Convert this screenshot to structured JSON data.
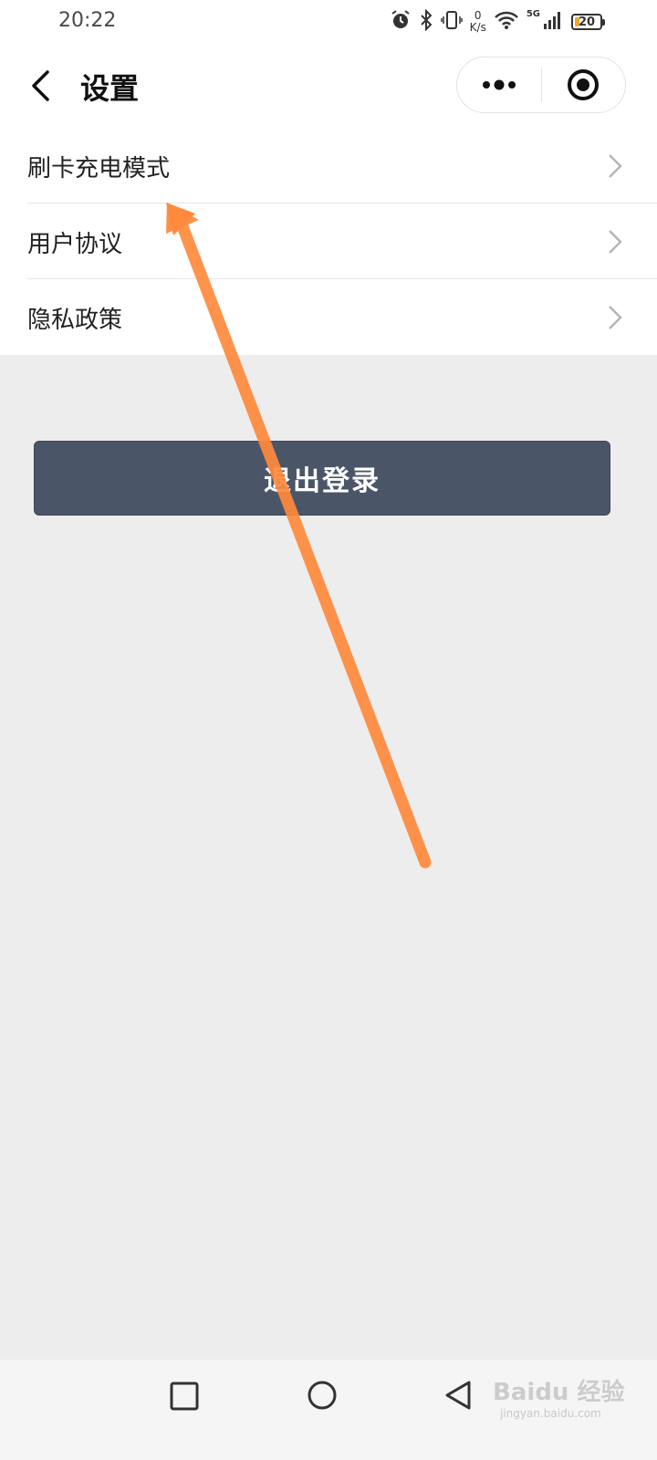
{
  "status_bar": {
    "time": "20:22",
    "net_speed_value": "0",
    "net_speed_unit": "K/s",
    "signal_label": "5G",
    "battery": "20",
    "battery_level": 0.2
  },
  "nav": {
    "title": "设置"
  },
  "menu": {
    "items": [
      {
        "label": "刷卡充电模式"
      },
      {
        "label": "用户协议"
      },
      {
        "label": "隐私政策"
      }
    ]
  },
  "logout": {
    "label": "退出登录"
  },
  "watermark": {
    "brand": "Baidu 经验",
    "url": "jingyan.baidu.com"
  },
  "colors": {
    "logout_bg": "#4b5568",
    "arrow": "#ff8a3d",
    "page_bg": "#ededed"
  }
}
